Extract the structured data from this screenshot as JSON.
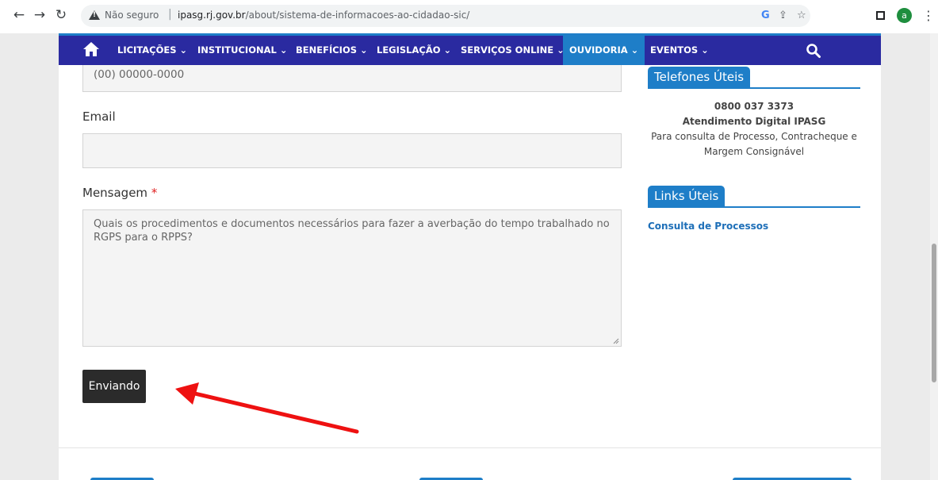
{
  "browser": {
    "insecure_label": "Não seguro",
    "url_domain": "ipasg.rj.gov.br",
    "url_path": "/about/sistema-de-informacoes-ao-cidadao-sic/",
    "avatar_letter": "a",
    "icons": [
      "back-icon",
      "forward-icon",
      "reload-icon",
      "warning-icon",
      "google-icon",
      "share-icon",
      "star-icon",
      "side-panel-icon",
      "menu-icon"
    ]
  },
  "navbar": {
    "items": [
      {
        "label": "LICITAÇÕES ⌄"
      },
      {
        "label": "INSTITUCIONAL ⌄"
      },
      {
        "label": "BENEFÍCIOS ⌄"
      },
      {
        "label": "LEGISLAÇÃO ⌄"
      },
      {
        "label": "SERVIÇOS ONLINE ⌄"
      },
      {
        "label": "OUVIDORIA ⌄"
      },
      {
        "label": "EVENTOS ⌄"
      }
    ],
    "active": "OUVIDORIA",
    "colors": {
      "bar": "#2a2aa0",
      "accent": "#1e7ec8"
    }
  },
  "form": {
    "phone_placeholder": "(00) 00000-0000",
    "email_label": "Email",
    "message_label": "Mensagem",
    "required_mark": "*",
    "message_value": "Quais os procedimentos e documentos necessários para fazer a averbação do tempo trabalhado no RGPS para o RPPS?",
    "submit_label": "Enviando"
  },
  "sidebar": {
    "phones_title": "Telefones Úteis",
    "phone_number": "0800 037 3373",
    "phone_service": "Atendimento Digital IPASG",
    "phone_desc": "Para consulta de Processo, Contracheque e Margem Consignável",
    "links_title": "Links Úteis",
    "links": [
      {
        "label": "Consulta de Processos"
      }
    ]
  },
  "annotation": {
    "arrow_color": "#ee1111"
  }
}
